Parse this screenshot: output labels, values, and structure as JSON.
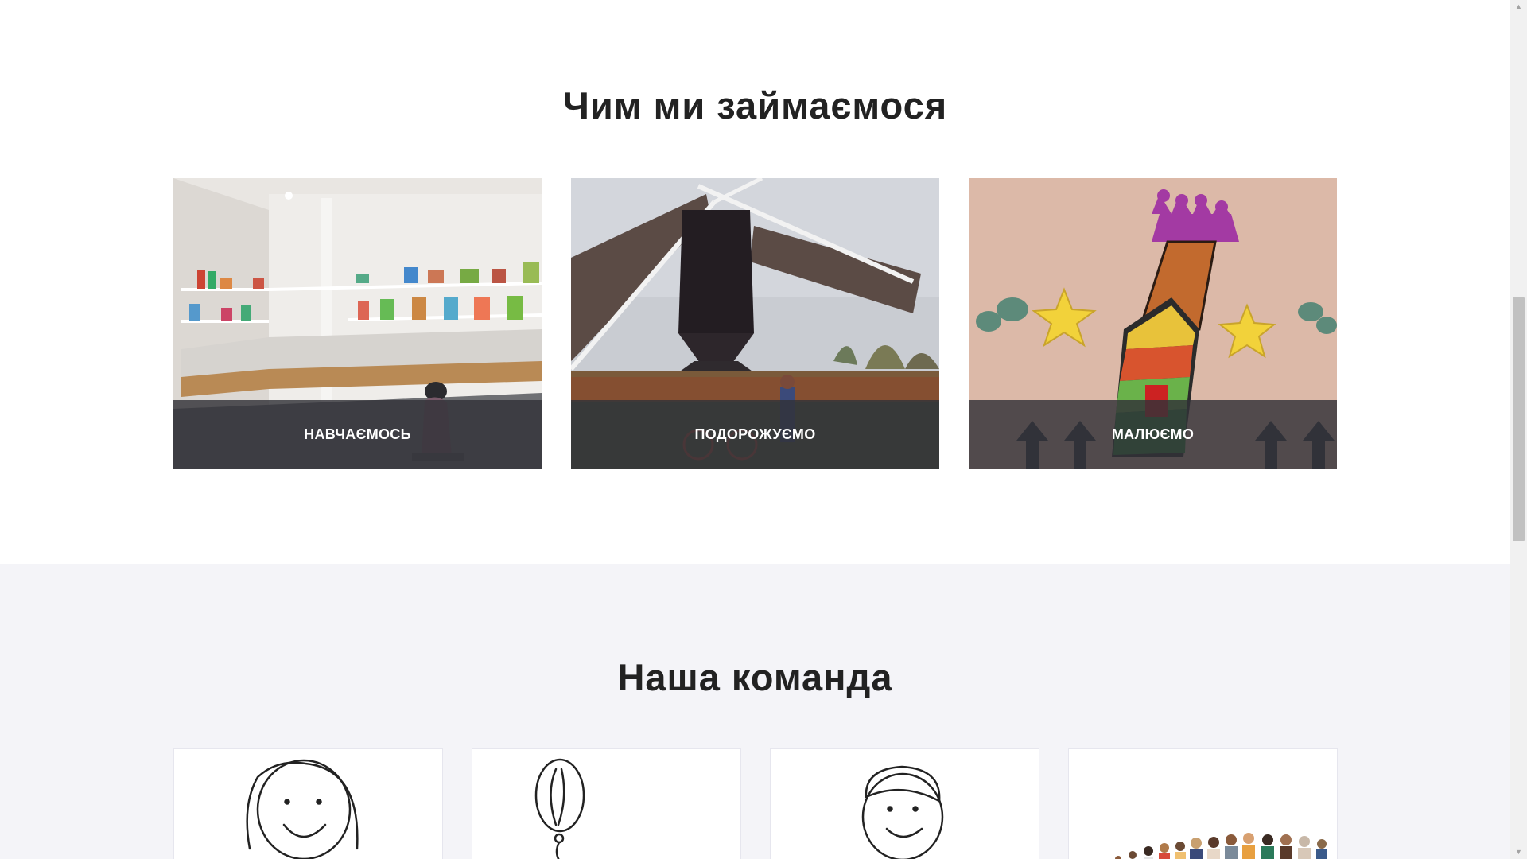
{
  "activities": {
    "title": "Чим ми займаємося",
    "cards": [
      {
        "label": "НАВЧАЄМОСЬ"
      },
      {
        "label": "ПОДОРОЖУЄМО"
      },
      {
        "label": "МАЛЮЄМО"
      }
    ]
  },
  "team": {
    "title": "Наша команда"
  }
}
